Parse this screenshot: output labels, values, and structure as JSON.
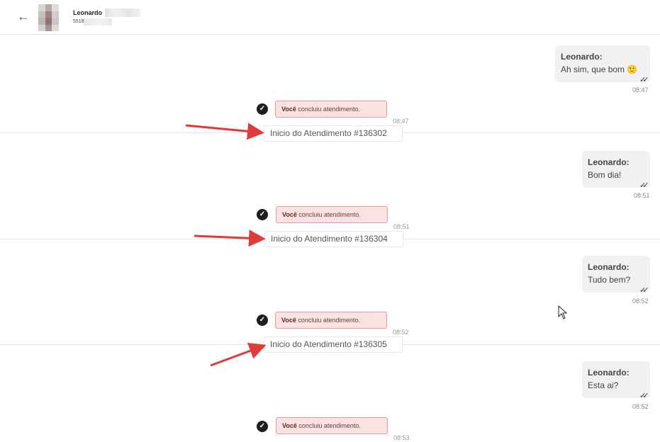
{
  "header": {
    "back_icon": "arrow-left-icon",
    "contact_name": "Leonardo",
    "contact_phone": "5518"
  },
  "messages": [
    {
      "sender": "Leonardo:",
      "text": "Ah sim, que bom 🙂",
      "time": "08:47"
    },
    {
      "sender": "Leonardo:",
      "text": "Bom dia!",
      "time": "08:51"
    },
    {
      "sender": "Leonardo:",
      "text": "Tudo bem?",
      "time": "08:52"
    },
    {
      "sender": "Leonardo:",
      "text": "Esta ai?",
      "time": "08:52"
    }
  ],
  "system_events": [
    {
      "actor": "Você",
      "action": "concluiu atendimento.",
      "time": "08:47"
    },
    {
      "actor": "Você",
      "action": "concluiu atendimento.",
      "time": "08:51"
    },
    {
      "actor": "Você",
      "action": "concluiu atendimento.",
      "time": "08:52"
    },
    {
      "actor": "Você",
      "action": "concluiu atendimento.",
      "time": "08:53"
    }
  ],
  "session_starts": [
    {
      "label": "Inicio do Atendimento #136302"
    },
    {
      "label": "Inicio do Atendimento #136304"
    },
    {
      "label": "Inicio do Atendimento #136305"
    }
  ],
  "colors": {
    "annotation_arrow": "#e03b3b",
    "concluded_bg": "#fbe2e2",
    "concluded_border": "#e89a9a",
    "bubble_bg": "#f1f1f1"
  },
  "glyphs": {
    "check": "✓",
    "double_tick": "✓✓",
    "back": "←"
  }
}
